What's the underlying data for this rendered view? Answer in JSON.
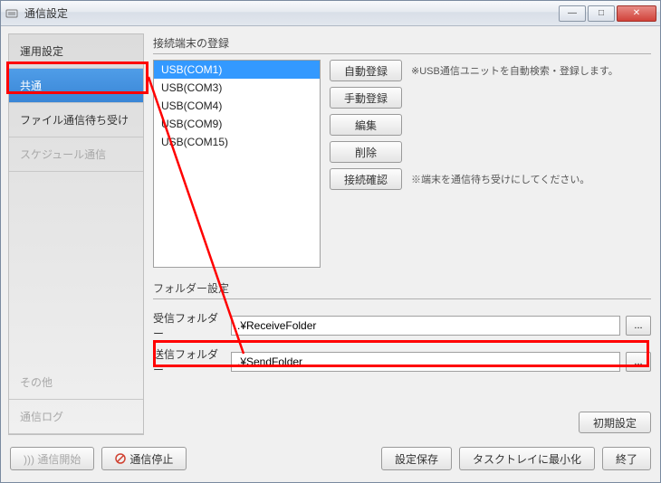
{
  "window": {
    "title": "通信設定"
  },
  "titlebar_buttons": {
    "min": "—",
    "max": "□",
    "close": "✕"
  },
  "sidebar": {
    "items": [
      {
        "label": "運用設定",
        "selected": false,
        "disabled": false
      },
      {
        "label": "共通",
        "selected": true,
        "disabled": false
      },
      {
        "label": "ファイル通信待ち受け",
        "selected": false,
        "disabled": false
      },
      {
        "label": "スケジュール通信",
        "selected": false,
        "disabled": true
      }
    ],
    "bottom_items": [
      {
        "label": "その他",
        "disabled": true
      },
      {
        "label": "通信ログ",
        "disabled": true
      }
    ]
  },
  "terminal": {
    "group_title": "接続端末の登録",
    "list": [
      {
        "label": "USB(COM1)",
        "selected": true
      },
      {
        "label": "USB(COM3)",
        "selected": false
      },
      {
        "label": "USB(COM4)",
        "selected": false
      },
      {
        "label": "USB(COM9)",
        "selected": false
      },
      {
        "label": "USB(COM15)",
        "selected": false
      }
    ],
    "buttons": {
      "auto": "自動登録",
      "auto_hint": "※USB通信ユニットを自動検索・登録します。",
      "manual": "手動登録",
      "edit": "編集",
      "delete": "削除",
      "check": "接続確認",
      "check_hint": "※端末を通信待ち受けにしてください。"
    }
  },
  "folder": {
    "group_title": "フォルダー設定",
    "receive_label": "受信フォルダー",
    "receive_value": ".¥ReceiveFolder",
    "send_label": "送信フォルダー",
    "send_value": ".¥SendFolder",
    "browse": "..."
  },
  "init_button": "初期設定",
  "footer": {
    "start": "))) 通信開始",
    "stop": "通信停止",
    "save": "設定保存",
    "minimize": "タスクトレイに最小化",
    "close": "終了"
  }
}
